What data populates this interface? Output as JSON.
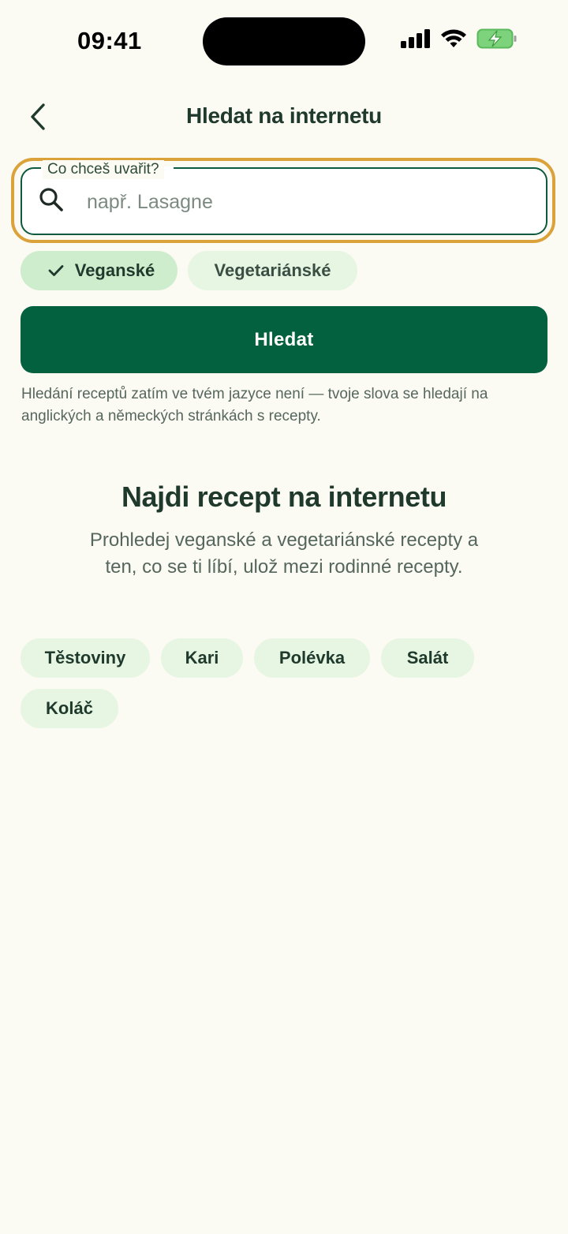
{
  "status_bar": {
    "time": "09:41"
  },
  "header": {
    "title": "Hledat na internetu"
  },
  "search": {
    "label": "Co chceš uvařit?",
    "placeholder": "např. Lasagne",
    "value": ""
  },
  "filters": [
    {
      "label": "Veganské",
      "selected": true
    },
    {
      "label": "Vegetariánské",
      "selected": false
    }
  ],
  "search_button": {
    "label": "Hledat"
  },
  "hint": "Hledání receptů zatím ve tvém jazyce není — tvoje slova se hledají na anglických a německých stránkách s recepty.",
  "empty_state": {
    "title": "Najdi recept na internetu",
    "description": "Prohledej veganské a vegetariánské recepty a ten, co se ti líbí, ulož mezi rodinné recepty."
  },
  "suggestions": [
    "Těstoviny",
    "Kari",
    "Polévka",
    "Salát",
    "Koláč"
  ],
  "colors": {
    "background": "#fbfaf3",
    "primary": "#046140",
    "focus_ring": "#dca23a",
    "chip_selected": "#cdedcd",
    "chip": "#e6f6e2"
  }
}
